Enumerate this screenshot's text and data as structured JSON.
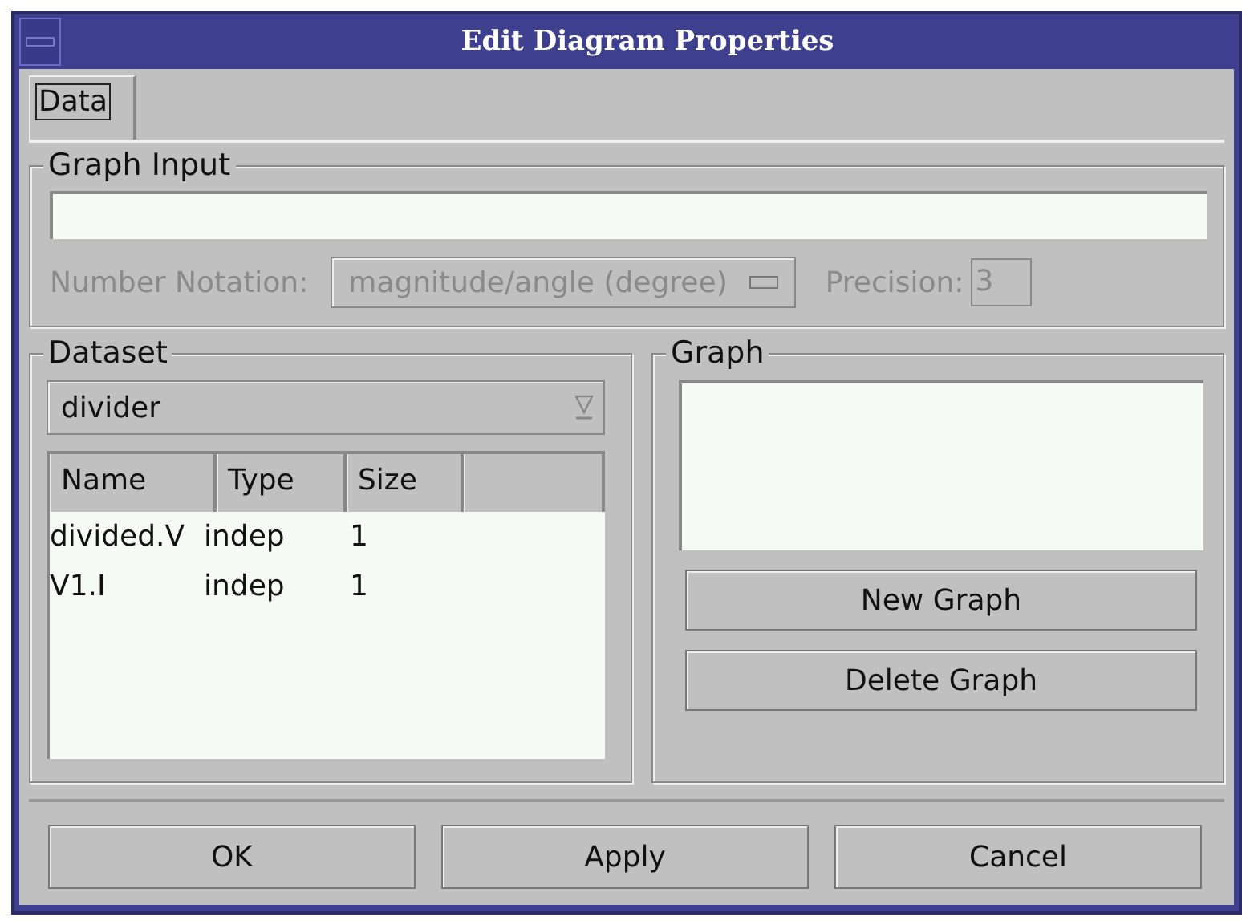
{
  "window": {
    "title": "Edit Diagram Properties"
  },
  "tabs": [
    {
      "label": "Data",
      "selected": true
    }
  ],
  "graph_input": {
    "title": "Graph Input",
    "notation": {
      "label": "Number Notation:",
      "value": "magnitude/angle (degree)",
      "disabled": true
    },
    "precision": {
      "label": "Precision:",
      "value": "3",
      "disabled": true
    }
  },
  "dataset": {
    "title": "Dataset",
    "dropdown": "divider",
    "columns": [
      "Name",
      "Type",
      "Size"
    ],
    "rows": [
      [
        "divided.V",
        "indep",
        "1"
      ],
      [
        "V1.I",
        "indep",
        "1"
      ]
    ]
  },
  "graph": {
    "title": "Graph",
    "buttons": [
      "New Graph",
      "Delete Graph"
    ]
  },
  "buttons": [
    "OK",
    "Apply",
    "Cancel"
  ]
}
